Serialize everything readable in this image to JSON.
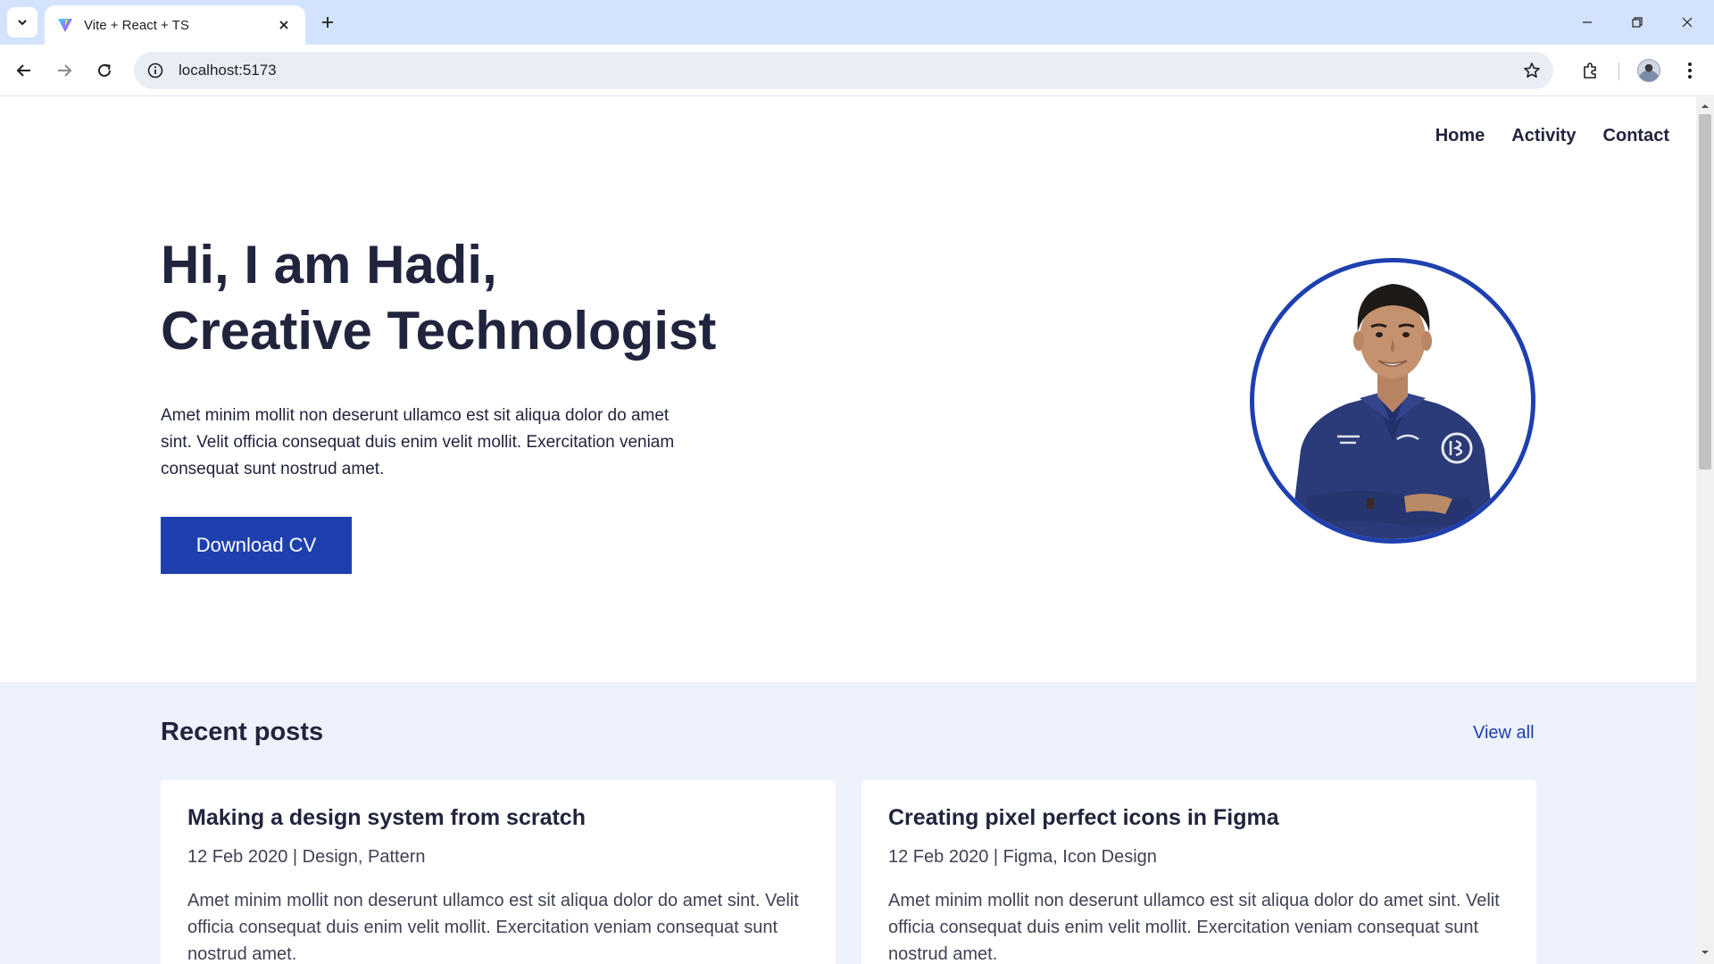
{
  "browser": {
    "tab_title": "Vite + React + TS",
    "url": "localhost:5173"
  },
  "nav": {
    "items": [
      {
        "label": "Home"
      },
      {
        "label": "Activity"
      },
      {
        "label": "Contact"
      }
    ]
  },
  "hero": {
    "line1": "Hi, I am Hadi,",
    "line2": "Creative Technologist",
    "description": "Amet minim mollit non deserunt ullamco est sit aliqua dolor do amet sint. Velit officia consequat duis enim velit mollit. Exercitation veniam consequat sunt nostrud amet.",
    "cta_label": "Download CV"
  },
  "posts": {
    "title": "Recent posts",
    "view_all_label": "View all",
    "items": [
      {
        "title": "Making a design system from scratch",
        "meta": "12 Feb 2020 | Design, Pattern",
        "excerpt": "Amet minim mollit non deserunt ullamco est sit aliqua dolor do amet sint. Velit officia consequat duis enim velit mollit. Exercitation veniam consequat sunt nostrud amet."
      },
      {
        "title": "Creating pixel perfect icons in Figma",
        "meta": "12 Feb 2020 | Figma, Icon Design",
        "excerpt": "Amet minim mollit non deserunt ullamco est sit aliqua dolor do amet sint. Velit officia consequat duis enim velit mollit. Exercitation veniam consequat sunt nostrud amet."
      }
    ]
  },
  "colors": {
    "accent": "#1e40af",
    "text": "#21243d",
    "posts_bg": "#edf2fd",
    "chrome_bg": "#d3e3fd"
  }
}
